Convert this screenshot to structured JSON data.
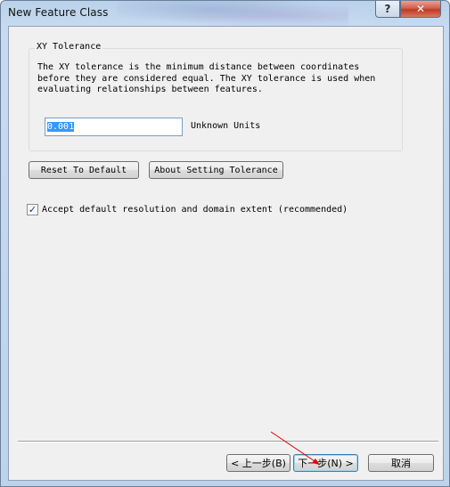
{
  "window": {
    "title": "New Feature Class",
    "help_label": "?",
    "close_label": "✕"
  },
  "xy_tolerance": {
    "group_label": "XY Tolerance",
    "description": "The XY tolerance is the minimum distance between coordinates before they are considered equal. The XY tolerance is used when evaluating relationships between features.",
    "value": "0.001",
    "units": "Unknown Units"
  },
  "actions": {
    "reset_label": "Reset To Default",
    "about_label": "About Setting Tolerance"
  },
  "accept_default": {
    "checked": true,
    "check_mark": "✓",
    "label": "Accept default resolution and domain extent (recommended)"
  },
  "footer": {
    "back_label": "< 上一步(B)",
    "next_label": "下一步(N) >",
    "cancel_label": "取消"
  },
  "colors": {
    "accent": "#3399ff",
    "annotation_arrow": "#e00000"
  }
}
